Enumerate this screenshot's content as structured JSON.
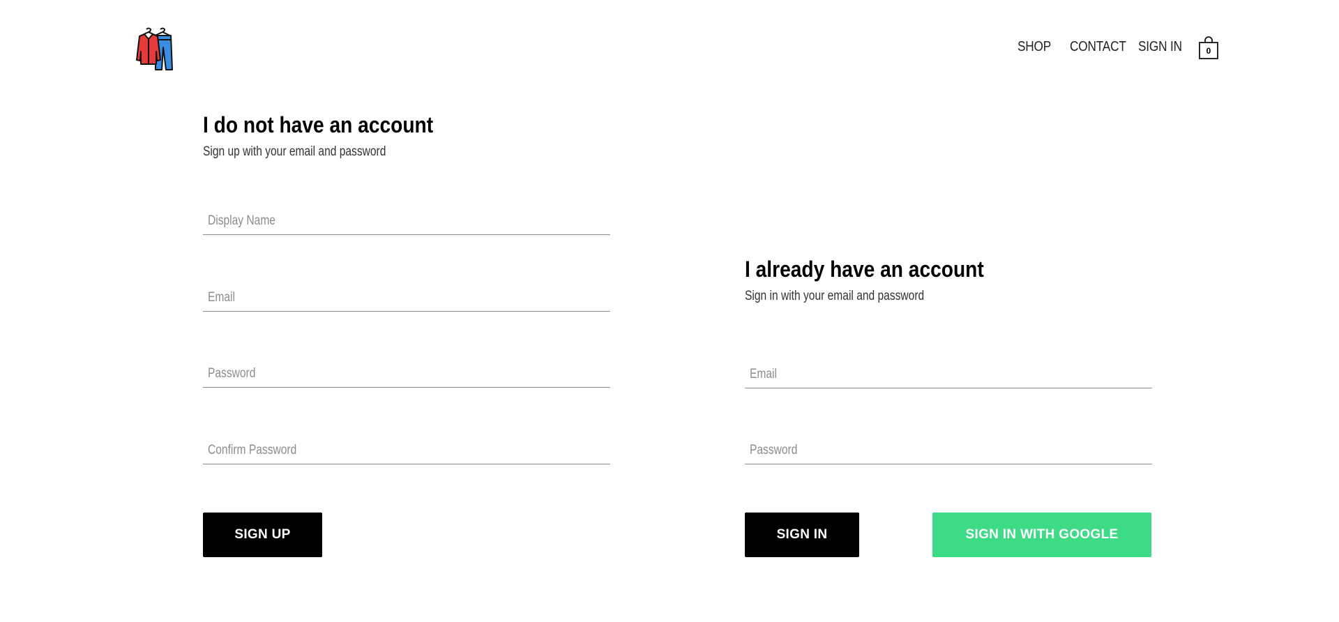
{
  "header": {
    "nav": {
      "shop": "SHOP",
      "contact": "CONTACT",
      "sign_in": "SIGN IN"
    },
    "cart_count": "0",
    "logo_icon": "clothes-hanger-logo"
  },
  "signup": {
    "title": "I do not have an account",
    "subtitle": "Sign up with your email and password",
    "fields": {
      "display_name": "Display Name",
      "email": "Email",
      "password": "Password",
      "confirm_password": "Confirm Password"
    },
    "button_label": "SIGN UP"
  },
  "signin": {
    "title": "I already have an account",
    "subtitle": "Sign in with your email and password",
    "fields": {
      "email": "Email",
      "password": "Password"
    },
    "button_label": "SIGN IN",
    "google_button_label": "SIGN IN WITH GOOGLE"
  },
  "colors": {
    "google_button": "#3ddb86",
    "primary_button": "#000000",
    "jacket_red": "#e63b3b",
    "pants_blue": "#3a8de0"
  }
}
